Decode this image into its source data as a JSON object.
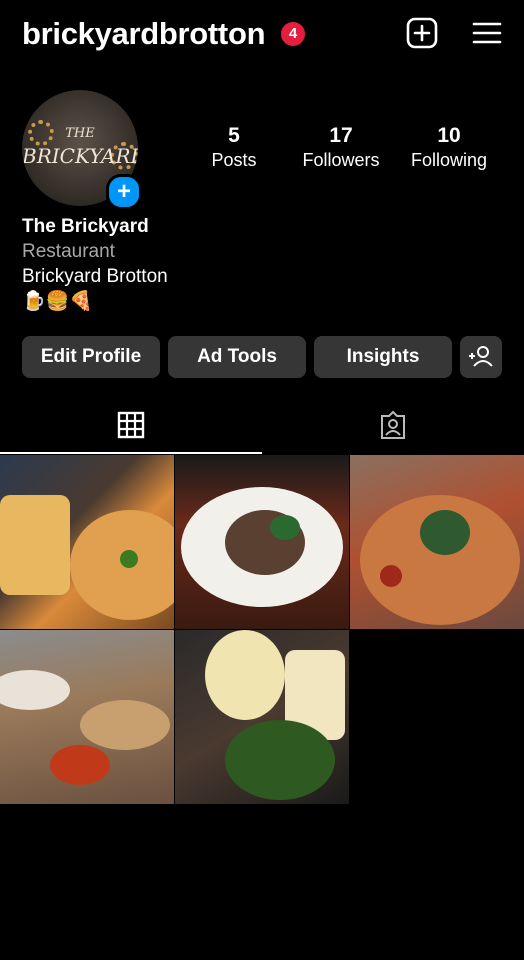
{
  "header": {
    "username": "brickyardbrotton",
    "notification_count": "4",
    "create_icon": "plus-square-icon",
    "menu_icon": "hamburger-menu-icon"
  },
  "profile": {
    "avatar_text_the": "THE",
    "avatar_text_main": "BRICKYARD",
    "stats": {
      "posts_count": "5",
      "posts_label": "Posts",
      "followers_count": "17",
      "followers_label": "Followers",
      "following_count": "10",
      "following_label": "Following"
    },
    "name": "The Brickyard",
    "category": "Restaurant",
    "bio": "Brickyard Brotton",
    "emojis": "🍺🍔🍕"
  },
  "actions": {
    "edit_profile": "Edit Profile",
    "ad_tools": "Ad Tools",
    "insights": "Insights",
    "discover_icon": "add-person-icon"
  },
  "tabs": [
    {
      "icon": "grid-icon",
      "active": true
    },
    {
      "icon": "tagged-person-icon",
      "active": false
    }
  ],
  "posts": [
    {
      "icon": "pizza-with-fries-photo"
    },
    {
      "icon": "plated-dish-photo"
    },
    {
      "icon": "pizza-photo"
    },
    {
      "icon": "table-of-food-photo"
    },
    {
      "icon": "salad-and-fries-photo"
    }
  ],
  "colors": {
    "background": "#000000",
    "button": "#363636",
    "accent_blue": "#0095f6",
    "badge_red": "#e41e3f",
    "secondary_text": "#a8a8a8"
  }
}
